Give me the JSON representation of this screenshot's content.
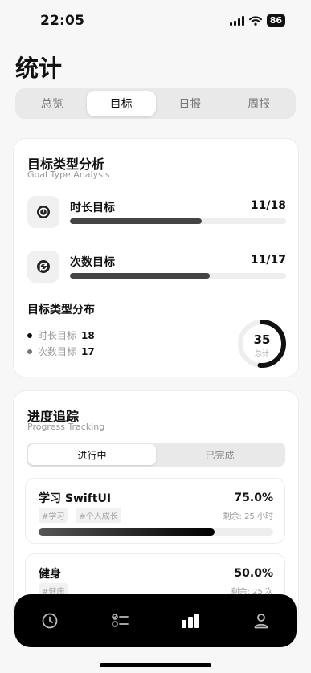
{
  "status_bar": {
    "time": "22:05",
    "battery": "86"
  },
  "page_title": "统计",
  "tabs": [
    {
      "label": "总览",
      "active": false
    },
    {
      "label": "目标",
      "active": true
    },
    {
      "label": "日报",
      "active": false
    },
    {
      "label": "周报",
      "active": false
    }
  ],
  "type_analysis": {
    "title": "目标类型分析",
    "subtitle": "Goal Type Analysis",
    "rows": [
      {
        "name": "时长目标",
        "count": "11/18",
        "progress": 0.611,
        "icon": "timer-icon"
      },
      {
        "name": "次数目标",
        "count": "11/17",
        "progress": 0.647,
        "icon": "repeat-icon"
      }
    ],
    "distribution": {
      "title": "目标类型分布",
      "items": [
        {
          "label": "时长目标",
          "value": "18",
          "color": "#111111"
        },
        {
          "label": "次数目标",
          "value": "17",
          "color": "#777777"
        }
      ],
      "total": "35",
      "total_label": "总计"
    }
  },
  "progress_tracking": {
    "title": "进度追踪",
    "subtitle": "Progress Tracking",
    "segments": [
      {
        "label": "进行中",
        "active": true
      },
      {
        "label": "已完成",
        "active": false
      }
    ],
    "goals": [
      {
        "title": "学习 SwiftUI",
        "percent": "75.0%",
        "progress": 0.75,
        "tags": [
          "#学习",
          "#个人成长"
        ],
        "remaining": "剩余: 25 小时"
      },
      {
        "title": "健身",
        "percent": "50.0%",
        "progress": 0.5,
        "tags": [
          "#健康"
        ],
        "remaining": "剩余: 25 次"
      }
    ]
  },
  "tab_bar": {
    "items": [
      {
        "icon": "clock-icon",
        "active": false
      },
      {
        "icon": "checklist-icon",
        "active": false
      },
      {
        "icon": "bar-chart-icon",
        "active": true
      },
      {
        "icon": "person-icon",
        "active": false
      }
    ]
  }
}
